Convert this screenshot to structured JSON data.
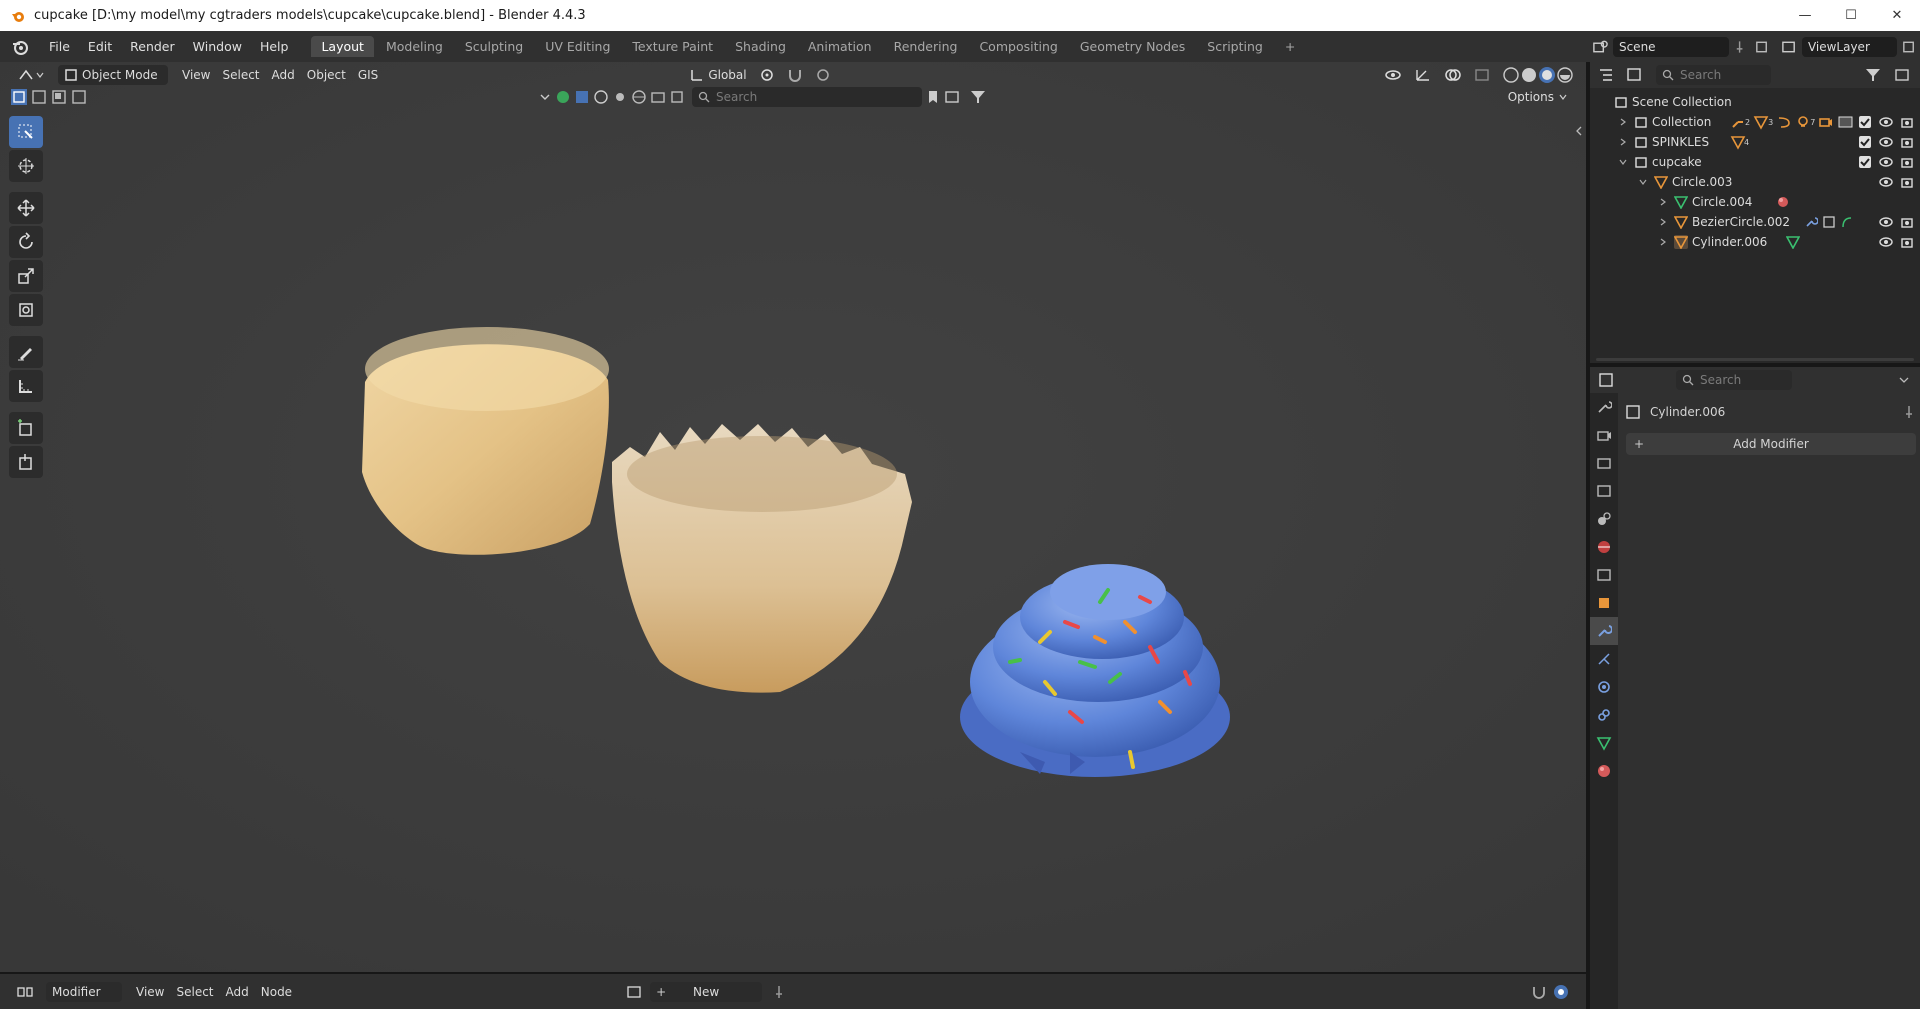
{
  "window": {
    "title": "cupcake [D:\\my model\\my cgtraders models\\cupcake\\cupcake.blend] - Blender 4.4.3",
    "minimize": "—",
    "maximize": "☐",
    "close": "✕"
  },
  "menus": [
    "File",
    "Edit",
    "Render",
    "Window",
    "Help"
  ],
  "workspace_tabs": [
    "Layout",
    "Modeling",
    "Sculpting",
    "UV Editing",
    "Texture Paint",
    "Shading",
    "Animation",
    "Rendering",
    "Compositing",
    "Geometry Nodes",
    "Scripting",
    "+"
  ],
  "active_tab": "Layout",
  "scene": {
    "name": "Scene",
    "view_layer": "ViewLayer"
  },
  "viewport": {
    "mode": "Object Mode",
    "menus": [
      "View",
      "Select",
      "Add",
      "Object",
      "GIS"
    ],
    "orientation": "Global",
    "search_placeholder": "Search",
    "options_label": "Options"
  },
  "tools": [
    "select-box",
    "cursor",
    "move",
    "rotate",
    "scale",
    "transform",
    "annotate",
    "measure",
    "add-cube",
    "extrude"
  ],
  "outliner": {
    "search_placeholder": "Search",
    "items": [
      {
        "label": "Scene Collection",
        "depth": 0,
        "kind": "scene-collection"
      },
      {
        "label": "Collection",
        "depth": 1,
        "kind": "collection",
        "subscripts": [
          "2",
          "3",
          "",
          "7",
          ""
        ]
      },
      {
        "label": "SPINKLES",
        "depth": 1,
        "kind": "collection",
        "subscripts": [
          "4"
        ]
      },
      {
        "label": "cupcake",
        "depth": 1,
        "kind": "collection"
      },
      {
        "label": "Circle.003",
        "depth": 2,
        "kind": "mesh"
      },
      {
        "label": "Circle.004",
        "depth": 3,
        "kind": "mesh-data"
      },
      {
        "label": "BezierCircle.002",
        "depth": 3,
        "kind": "mesh"
      },
      {
        "label": "Cylinder.006",
        "depth": 3,
        "kind": "mesh"
      }
    ]
  },
  "properties": {
    "search_placeholder": "Search",
    "object_name": "Cylinder.006",
    "add_modifier": "Add Modifier"
  },
  "bottom": {
    "editor": "Modifier",
    "menus": [
      "View",
      "Select",
      "Add",
      "Node"
    ],
    "new_label": "New"
  },
  "colors": {
    "accent": "#4772b3",
    "frosting": "#5a82d8",
    "cake": "#e2bf82",
    "liner": "#d8bf96"
  }
}
